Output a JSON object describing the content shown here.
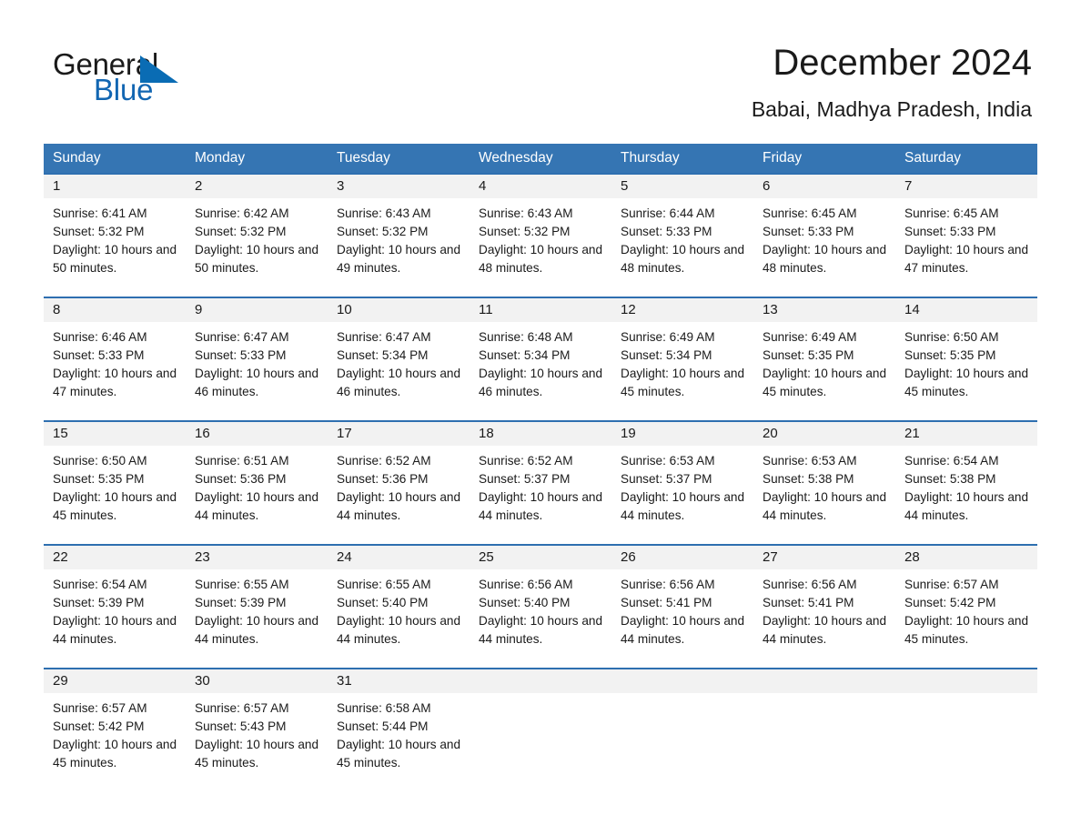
{
  "brand": {
    "name_part1": "General",
    "name_part2": "Blue",
    "triangle_color": "#0a6cb4",
    "blue_color": "#1266b2"
  },
  "header": {
    "title": "December 2024",
    "subtitle": "Babai, Madhya Pradesh, India",
    "accent_color": "#3575b3"
  },
  "weekdays": [
    "Sunday",
    "Monday",
    "Tuesday",
    "Wednesday",
    "Thursday",
    "Friday",
    "Saturday"
  ],
  "labels": {
    "sunrise_prefix": "Sunrise:",
    "sunset_prefix": "Sunset:",
    "daylight_prefix": "Daylight:"
  },
  "weeks": [
    [
      {
        "day": "1",
        "sunrise": "Sunrise: 6:41 AM",
        "sunset": "Sunset: 5:32 PM",
        "daylight": "Daylight: 10 hours and 50 minutes."
      },
      {
        "day": "2",
        "sunrise": "Sunrise: 6:42 AM",
        "sunset": "Sunset: 5:32 PM",
        "daylight": "Daylight: 10 hours and 50 minutes."
      },
      {
        "day": "3",
        "sunrise": "Sunrise: 6:43 AM",
        "sunset": "Sunset: 5:32 PM",
        "daylight": "Daylight: 10 hours and 49 minutes."
      },
      {
        "day": "4",
        "sunrise": "Sunrise: 6:43 AM",
        "sunset": "Sunset: 5:32 PM",
        "daylight": "Daylight: 10 hours and 48 minutes."
      },
      {
        "day": "5",
        "sunrise": "Sunrise: 6:44 AM",
        "sunset": "Sunset: 5:33 PM",
        "daylight": "Daylight: 10 hours and 48 minutes."
      },
      {
        "day": "6",
        "sunrise": "Sunrise: 6:45 AM",
        "sunset": "Sunset: 5:33 PM",
        "daylight": "Daylight: 10 hours and 48 minutes."
      },
      {
        "day": "7",
        "sunrise": "Sunrise: 6:45 AM",
        "sunset": "Sunset: 5:33 PM",
        "daylight": "Daylight: 10 hours and 47 minutes."
      }
    ],
    [
      {
        "day": "8",
        "sunrise": "Sunrise: 6:46 AM",
        "sunset": "Sunset: 5:33 PM",
        "daylight": "Daylight: 10 hours and 47 minutes."
      },
      {
        "day": "9",
        "sunrise": "Sunrise: 6:47 AM",
        "sunset": "Sunset: 5:33 PM",
        "daylight": "Daylight: 10 hours and 46 minutes."
      },
      {
        "day": "10",
        "sunrise": "Sunrise: 6:47 AM",
        "sunset": "Sunset: 5:34 PM",
        "daylight": "Daylight: 10 hours and 46 minutes."
      },
      {
        "day": "11",
        "sunrise": "Sunrise: 6:48 AM",
        "sunset": "Sunset: 5:34 PM",
        "daylight": "Daylight: 10 hours and 46 minutes."
      },
      {
        "day": "12",
        "sunrise": "Sunrise: 6:49 AM",
        "sunset": "Sunset: 5:34 PM",
        "daylight": "Daylight: 10 hours and 45 minutes."
      },
      {
        "day": "13",
        "sunrise": "Sunrise: 6:49 AM",
        "sunset": "Sunset: 5:35 PM",
        "daylight": "Daylight: 10 hours and 45 minutes."
      },
      {
        "day": "14",
        "sunrise": "Sunrise: 6:50 AM",
        "sunset": "Sunset: 5:35 PM",
        "daylight": "Daylight: 10 hours and 45 minutes."
      }
    ],
    [
      {
        "day": "15",
        "sunrise": "Sunrise: 6:50 AM",
        "sunset": "Sunset: 5:35 PM",
        "daylight": "Daylight: 10 hours and 45 minutes."
      },
      {
        "day": "16",
        "sunrise": "Sunrise: 6:51 AM",
        "sunset": "Sunset: 5:36 PM",
        "daylight": "Daylight: 10 hours and 44 minutes."
      },
      {
        "day": "17",
        "sunrise": "Sunrise: 6:52 AM",
        "sunset": "Sunset: 5:36 PM",
        "daylight": "Daylight: 10 hours and 44 minutes."
      },
      {
        "day": "18",
        "sunrise": "Sunrise: 6:52 AM",
        "sunset": "Sunset: 5:37 PM",
        "daylight": "Daylight: 10 hours and 44 minutes."
      },
      {
        "day": "19",
        "sunrise": "Sunrise: 6:53 AM",
        "sunset": "Sunset: 5:37 PM",
        "daylight": "Daylight: 10 hours and 44 minutes."
      },
      {
        "day": "20",
        "sunrise": "Sunrise: 6:53 AM",
        "sunset": "Sunset: 5:38 PM",
        "daylight": "Daylight: 10 hours and 44 minutes."
      },
      {
        "day": "21",
        "sunrise": "Sunrise: 6:54 AM",
        "sunset": "Sunset: 5:38 PM",
        "daylight": "Daylight: 10 hours and 44 minutes."
      }
    ],
    [
      {
        "day": "22",
        "sunrise": "Sunrise: 6:54 AM",
        "sunset": "Sunset: 5:39 PM",
        "daylight": "Daylight: 10 hours and 44 minutes."
      },
      {
        "day": "23",
        "sunrise": "Sunrise: 6:55 AM",
        "sunset": "Sunset: 5:39 PM",
        "daylight": "Daylight: 10 hours and 44 minutes."
      },
      {
        "day": "24",
        "sunrise": "Sunrise: 6:55 AM",
        "sunset": "Sunset: 5:40 PM",
        "daylight": "Daylight: 10 hours and 44 minutes."
      },
      {
        "day": "25",
        "sunrise": "Sunrise: 6:56 AM",
        "sunset": "Sunset: 5:40 PM",
        "daylight": "Daylight: 10 hours and 44 minutes."
      },
      {
        "day": "26",
        "sunrise": "Sunrise: 6:56 AM",
        "sunset": "Sunset: 5:41 PM",
        "daylight": "Daylight: 10 hours and 44 minutes."
      },
      {
        "day": "27",
        "sunrise": "Sunrise: 6:56 AM",
        "sunset": "Sunset: 5:41 PM",
        "daylight": "Daylight: 10 hours and 44 minutes."
      },
      {
        "day": "28",
        "sunrise": "Sunrise: 6:57 AM",
        "sunset": "Sunset: 5:42 PM",
        "daylight": "Daylight: 10 hours and 45 minutes."
      }
    ],
    [
      {
        "day": "29",
        "sunrise": "Sunrise: 6:57 AM",
        "sunset": "Sunset: 5:42 PM",
        "daylight": "Daylight: 10 hours and 45 minutes."
      },
      {
        "day": "30",
        "sunrise": "Sunrise: 6:57 AM",
        "sunset": "Sunset: 5:43 PM",
        "daylight": "Daylight: 10 hours and 45 minutes."
      },
      {
        "day": "31",
        "sunrise": "Sunrise: 6:58 AM",
        "sunset": "Sunset: 5:44 PM",
        "daylight": "Daylight: 10 hours and 45 minutes."
      },
      {
        "day": "",
        "sunrise": "",
        "sunset": "",
        "daylight": ""
      },
      {
        "day": "",
        "sunrise": "",
        "sunset": "",
        "daylight": ""
      },
      {
        "day": "",
        "sunrise": "",
        "sunset": "",
        "daylight": ""
      },
      {
        "day": "",
        "sunrise": "",
        "sunset": "",
        "daylight": ""
      }
    ]
  ]
}
